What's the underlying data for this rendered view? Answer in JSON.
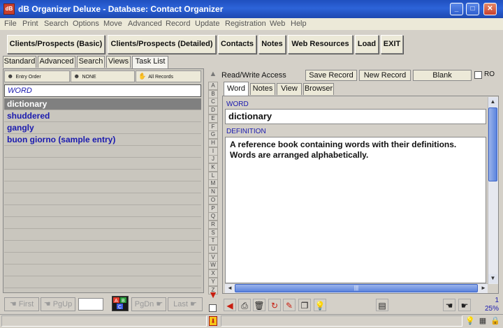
{
  "window": {
    "title": "dB Organizer Deluxe - Database: Contact Organizer",
    "icon": "dB",
    "minimize": "_",
    "maximize": "□",
    "close": "✕"
  },
  "menu": [
    "File",
    "Print",
    "Search",
    "Options",
    "Move",
    "Advanced",
    "Record",
    "Update",
    "Registration",
    "Web",
    "Help"
  ],
  "toolbar": {
    "buttons": [
      "Clients/Prospects (Basic)",
      "Clients/Prospects (Detailed)",
      "Contacts",
      "Notes",
      "Web Resources",
      "Load",
      "EXIT"
    ]
  },
  "left_tabs": {
    "items": [
      "Standard",
      "Advanced",
      "Search",
      "Views",
      "Task List"
    ],
    "active": "Task List"
  },
  "list": {
    "sort_order": "Entry Order",
    "filter": "NONE",
    "scope": "All Records",
    "column_header": "WORD",
    "rows": [
      "dictionary",
      "shuddered",
      "gangly",
      "buon giorno (sample entry)"
    ],
    "selected": "dictionary"
  },
  "alphabet": [
    "A",
    "B",
    "C",
    "D",
    "E",
    "F",
    "G",
    "H",
    "I",
    "J",
    "K",
    "L",
    "M",
    "N",
    "O",
    "P",
    "Q",
    "R",
    "S",
    "T",
    "U",
    "V",
    "W",
    "X",
    "Y",
    "Z"
  ],
  "record_header": {
    "access": "Read/Write Access",
    "save": "Save Record",
    "new": "New Record",
    "blank": "Blank",
    "ro": "RO"
  },
  "right_tabs": {
    "items": [
      "Word",
      "Notes",
      "View",
      "Browser"
    ],
    "active": "Word"
  },
  "record": {
    "word_label": "WORD",
    "word": "dictionary",
    "definition_label": "DEFINITION",
    "definition": "A reference book containing words with their definitions.\nWords are arranged alphabetically."
  },
  "nav": {
    "first": "First",
    "pgup": "PgUp",
    "pgdn": "PgDn",
    "last": "Last",
    "abc": "ABC"
  },
  "status": {
    "record_number": "1",
    "percent": "25%"
  },
  "colors": {
    "titlebar": "#2d63d8",
    "link_text": "#1a1aaf",
    "selected_row": "#808080",
    "scrollbar_thumb": "#5a83dd"
  }
}
